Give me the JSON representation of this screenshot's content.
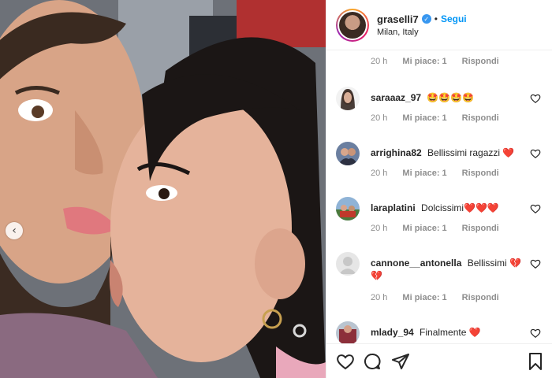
{
  "post": {
    "username": "graselli7",
    "separator": "•",
    "follow_label": "Segui",
    "location": "Milan, Italy",
    "verified_glyph": "✓"
  },
  "photo": {
    "prev_glyph": "‹"
  },
  "comments": {
    "first_meta": {
      "time": "20 h",
      "likes": "Mi piace: 1",
      "reply": "Rispondi"
    },
    "items": [
      {
        "user": "saraaaz_97",
        "text": "🤩🤩🤩🤩",
        "time": "20 h",
        "likes": "Mi piace: 1",
        "reply": "Rispondi"
      },
      {
        "user": "arrighina82",
        "text": "Bellissimi ragazzi ❤️",
        "time": "20 h",
        "likes": "Mi piace: 1",
        "reply": "Rispondi"
      },
      {
        "user": "laraplatini",
        "text": "Dolcissimi❤️❤️❤️",
        "time": "20 h",
        "likes": "Mi piace: 1",
        "reply": "Rispondi"
      },
      {
        "user": "cannone__antonella",
        "text": "Bellissimi 💔 💔",
        "time": "20 h",
        "likes": "Mi piace: 1",
        "reply": "Rispondi"
      },
      {
        "user": "mlady_94",
        "text": "Finalmente ❤️",
        "time": "",
        "likes": "",
        "reply": ""
      }
    ]
  },
  "icons": {
    "like": "heart-icon",
    "comment": "comment-icon",
    "share": "share-icon",
    "save": "bookmark-icon"
  },
  "colors": {
    "accent": "#0095f6",
    "verified": "#3897f0",
    "muted": "#8e8e8e"
  }
}
